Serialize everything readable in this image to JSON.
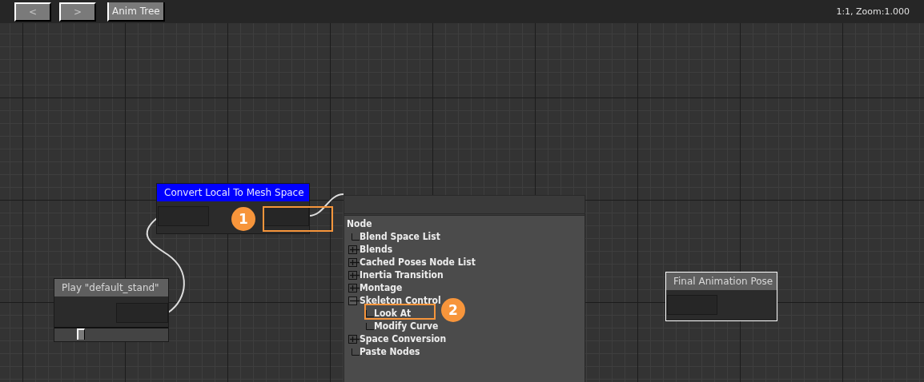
{
  "toolbar": {
    "buttons": [
      {
        "label": "<",
        "disabled": true
      },
      {
        "label": ">",
        "disabled": true
      },
      {
        "label": "Anim Tree",
        "disabled": false
      }
    ],
    "zoom_label": "1:1, Zoom:1.000"
  },
  "nodes": [
    {
      "title": "Convert Local To Mesh Space",
      "selected": true,
      "highlighted": false,
      "kind": "convert"
    },
    {
      "title": "Play \"default_stand\"",
      "selected": false,
      "highlighted": false,
      "kind": "play",
      "level": 0.2
    },
    {
      "title": "Final Animation Pose",
      "selected": false,
      "highlighted": true,
      "kind": "output"
    }
  ],
  "context_menu": {
    "tree": {
      "label": "Node",
      "children": [
        {
          "label": "Blend Space List",
          "kind": "leaf"
        },
        {
          "label": "Blends",
          "kind": "folder",
          "expanded": false
        },
        {
          "label": "Cached Poses Node List",
          "kind": "folder",
          "expanded": false
        },
        {
          "label": "Inertia Transition",
          "kind": "folder",
          "expanded": false
        },
        {
          "label": "Montage",
          "kind": "folder",
          "expanded": false
        },
        {
          "label": "Skeleton Control",
          "kind": "folder",
          "expanded": true,
          "children": [
            {
              "label": "Look At",
              "kind": "leaf"
            },
            {
              "label": "Modify Curve",
              "kind": "leaf"
            }
          ]
        },
        {
          "label": "Space Conversion",
          "kind": "folder",
          "expanded": false
        },
        {
          "label": "Paste Nodes",
          "kind": "leaf"
        }
      ]
    }
  },
  "callouts": [
    {
      "number": "1"
    },
    {
      "number": "2"
    }
  ]
}
